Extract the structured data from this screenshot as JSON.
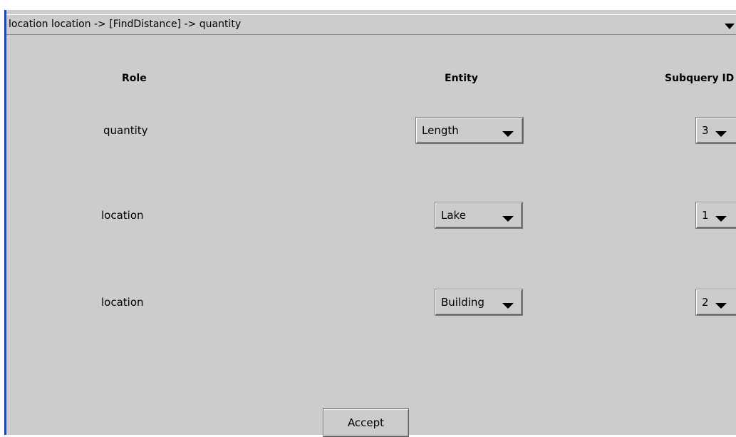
{
  "query_selector": {
    "value": "location location -> [FindDistance] -> quantity",
    "icon": "chevron-down-icon"
  },
  "headers": {
    "role": "Role",
    "entity": "Entity",
    "subquery_id": "Subquery ID"
  },
  "rows": [
    {
      "role": "quantity",
      "entity": "Length",
      "subquery_id": "3"
    },
    {
      "role": "location",
      "entity": "Lake",
      "subquery_id": "1"
    },
    {
      "role": "location",
      "entity": "Building",
      "subquery_id": "2"
    }
  ],
  "accept_label": "Accept",
  "colors": {
    "panel_background": "#cccccc",
    "left_accent": "#1c46a8"
  }
}
